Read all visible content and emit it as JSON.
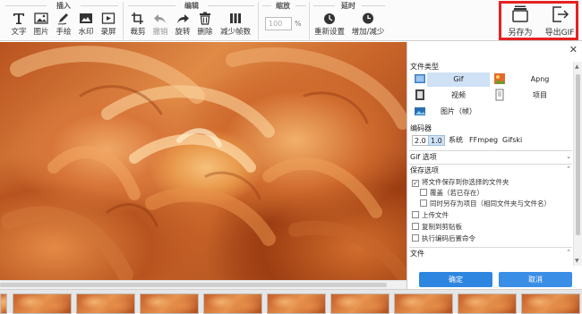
{
  "ribbon": {
    "groups": {
      "insert": "插入",
      "edit": "编辑",
      "zoom": "缩放",
      "delay": "延时"
    },
    "insert_tools": {
      "text": "文字",
      "image": "图片",
      "freehand": "手绘",
      "watermark": "水印",
      "record": "录屏"
    },
    "edit_tools": {
      "crop": "裁剪",
      "undo": "撤销",
      "rotate": "旋转",
      "delete": "删除",
      "reduce_frames": "减少帧数"
    },
    "zoom": {
      "value": "100",
      "unit": "%"
    },
    "delay_tools": {
      "reset": "重新设置",
      "increase_decrease": "增加/减少"
    },
    "save_as": "另存为",
    "export_gif": "导出GIF"
  },
  "panel": {
    "file_type_title": "文件类型",
    "types": {
      "gif": "Gif",
      "apng": "Apng",
      "video": "视频",
      "project": "项目",
      "images": "图片（帧）"
    },
    "encoder_title": "编码器",
    "encoders": {
      "v20": "2.0",
      "v10": "1.0",
      "system": "系统",
      "ffmpeg": "FFmpeg",
      "gifski": "Gifski"
    },
    "gif_options_title": "Gif 选项",
    "save_options_title": "保存选项",
    "options": {
      "save_to_folder": "将文件保存到你选择的文件夹",
      "overwrite": "覆盖（若已存在）",
      "save_project_too": "同时另存为项目（相同文件夹与文件名）",
      "upload": "上传文件",
      "copy_clipboard": "复制到剪贴板",
      "run_command": "执行编码后置命令"
    },
    "file_title": "文件",
    "ok": "确定",
    "cancel": "取消"
  },
  "colors": {
    "accent": "#2f86e0",
    "highlight": "#e52222",
    "selected_bg": "#cfe1f5"
  }
}
